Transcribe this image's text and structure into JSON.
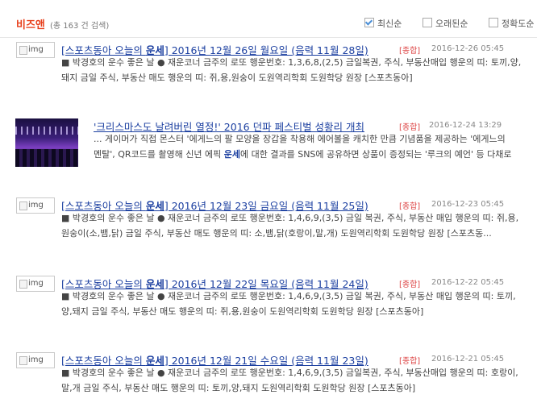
{
  "header": {
    "brand": "비즈앤",
    "count": "(총 163 건 검색)",
    "sort_options": [
      {
        "label": "최신순",
        "checked": true
      },
      {
        "label": "오래된순",
        "checked": false
      },
      {
        "label": "정확도순",
        "checked": false
      }
    ]
  },
  "results": [
    {
      "thumb_alt": "img",
      "title_pre": "[스포츠동아 오늘의 ",
      "title_hl": "운세",
      "title_post": "] 2016년 12월 26일 월요일 (음력 11월 28일)",
      "badge": "[종합]",
      "date": "2016-12-26 05:45",
      "line1": "■ 박경호의 운수 좋은 날 ● 재운코너 금주의 로또 행운번호: 1,3,6,8,(2,5) 금일복권, 주식, 부동산매입 행운의 띠: 토끼,양,",
      "line2": "돼지 금일 주식, 부동산 매도 행운의 띠: 쥐,용,원숭이 도원역리학회 도원학당 원장 [스포츠동아]"
    },
    {
      "thumb_alt": "",
      "title_pre": "'크리스마스도 날려버린 열정!' 2016 던파 페스티벌 성황리 개최",
      "title_hl": "",
      "title_post": "",
      "badge": "[종합]",
      "date": "2016-12-24 13:29",
      "line1": "... 게이머가 직접 몬스터 '에게느의 팔 모양을 장갑을 착용해 에어볼을 캐치한 만큼 기념품을 제공하는 '에게느의",
      "line2_pre": "멘탈', QR코드를 촬영해 신년 에픽 ",
      "line2_hl": "운세",
      "line2_post": "에 대한 결과를 SNS에 공유하면 상품이 증정되는 '루크의 예언' 등 다채로"
    },
    {
      "thumb_alt": "img",
      "title_pre": "[스포츠동아 오늘의 ",
      "title_hl": "운세",
      "title_post": "] 2016년 12월 23일 금요일 (음력 11월 25일)",
      "badge": "[종합]",
      "date": "2016-12-23 05:45",
      "line1": "■ 박경호의 운수 좋은 날 ● 재운코너 금주의 로또 행운번호: 1,4,6,9,(3,5) 금일 복권, 주식, 부동산 매입 행운의 띠: 쥐,용,",
      "line2": "원숭이(소,뱀,닭) 금일 주식, 부동산 매도 행운의 띠: 소,뱀,닭(호랑이,말,개) 도원역리학회 도원학당 원장 [스포츠동..."
    },
    {
      "thumb_alt": "img",
      "title_pre": "[스포츠동아 오늘의 ",
      "title_hl": "운세",
      "title_post": "] 2016년 12월 22일 목요일 (음력 11월 24일)",
      "badge": "[종합]",
      "date": "2016-12-22 05:45",
      "line1": "■ 박경호의 운수 좋은 날 ● 재운코너 금주의 로또 행운번호: 1,4,6,9,(3,5) 금일 복권, 주식, 부동산 매입 행운의 띠: 토끼,",
      "line2": "양,돼지 금일 주식, 부동산 매도 행운의 띠: 쥐,용,원숭이 도원역리학회 도원학당 원장 [스포츠동아]"
    },
    {
      "thumb_alt": "img",
      "title_pre": "[스포츠동아 오늘의 ",
      "title_hl": "운세",
      "title_post": "] 2016년 12월 21일 수요일 (음력 11월 23일)",
      "badge": "[종합]",
      "date": "2016-12-21 05:45",
      "line1": "■ 박경호의 운수 좋은 날 ● 재운코너 금주의 로또 행운번호: 1,4,6,9,(3,5) 금일복권, 주식, 부동산매입 행운의 띠: 호랑이,",
      "line2": "말,개 금일 주식, 부동산 매도 행운의 띠: 토끼,양,돼지 도원역리학회 도원학당 원장 [스포츠동아]"
    }
  ]
}
